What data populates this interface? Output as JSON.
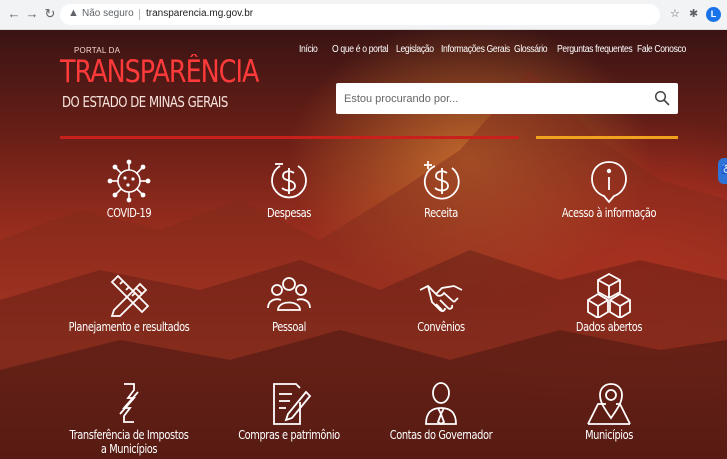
{
  "browser": {
    "security_label": "Não seguro",
    "url": "transparencia.mg.gov.br",
    "profile_initial": "L"
  },
  "brand": {
    "small": "PORTAL DA",
    "big": "TRANSPARÊNCIA",
    "sub": "DO ESTADO DE MINAS GERAIS"
  },
  "nav": {
    "items": [
      "Início",
      "O que é o portal",
      "Legislação",
      "Informações Gerais",
      "Glossário",
      "Perguntas frequentes",
      "Fale Conosco"
    ]
  },
  "search": {
    "placeholder": "Estou procurando por..."
  },
  "tiles": [
    {
      "label": "COVID-19",
      "icon": "virus-icon"
    },
    {
      "label": "Despesas",
      "icon": "money-minus-icon"
    },
    {
      "label": "Receita",
      "icon": "money-plus-icon"
    },
    {
      "label": "Acesso à informação",
      "icon": "info-icon"
    },
    {
      "label": "Planejamento e resultados",
      "icon": "pencil-ruler-icon"
    },
    {
      "label": "Pessoal",
      "icon": "people-icon"
    },
    {
      "label": "Convênios",
      "icon": "handshake-icon"
    },
    {
      "label": "Dados abertos",
      "icon": "cubes-icon"
    },
    {
      "label": "Transferência de Impostos a Municípios",
      "icon": "transfer-icon"
    },
    {
      "label": "Compras e patrimônio",
      "icon": "document-edit-icon"
    },
    {
      "label": "Contas do Governador",
      "icon": "person-tie-icon"
    },
    {
      "label": "Municípios",
      "icon": "map-pin-icon"
    }
  ],
  "colors": {
    "brand_red": "#ff3a3a",
    "divider_red": "#c9201b",
    "divider_orange": "#f0a21e",
    "accessibility_blue": "#2f73d7"
  }
}
